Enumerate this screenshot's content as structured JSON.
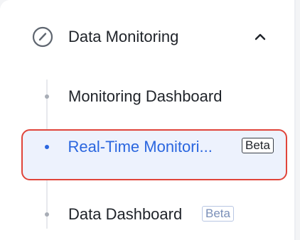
{
  "section": {
    "icon": "gauge-icon",
    "label": "Data Monitoring",
    "expand_icon": "chevron-up-icon"
  },
  "items": [
    {
      "label": "Monitoring Dashboard",
      "badge": ""
    },
    {
      "label": "Real-Time Monitori...",
      "badge": "Beta",
      "active": true
    },
    {
      "label": "Data Dashboard",
      "badge": "Beta"
    }
  ],
  "colors": {
    "active_text": "#2a66df",
    "active_background": "#edf2fd",
    "highlight_border": "#e0443a",
    "text": "#1f2329"
  }
}
